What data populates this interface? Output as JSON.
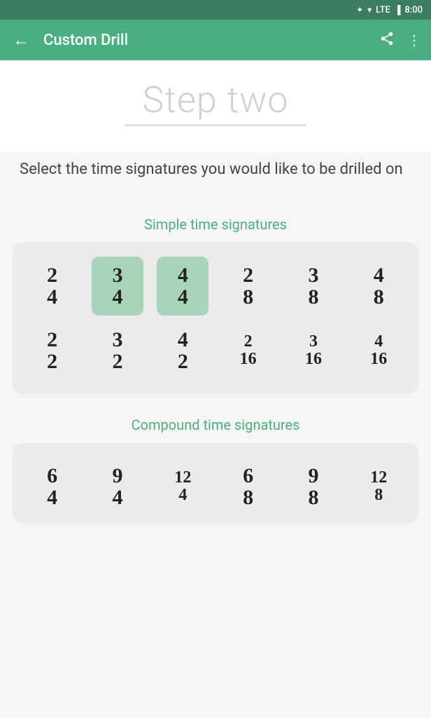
{
  "statusBar": {
    "time": "8:00",
    "bluetooth": "⚡",
    "wifi": "▲",
    "lte": "LTE",
    "battery": "▐"
  },
  "toolbar": {
    "back_icon": "←",
    "title": "Custom Drill",
    "share_icon": "⎋",
    "more_icon": "⋮"
  },
  "stepHeading": "Step two",
  "stepDescription": "Select the time signatures you would like to be drilled on",
  "simpleLabel": "Simple time signatures",
  "compoundLabel": "Compound time signatures",
  "simpleRow1": [
    {
      "top": "2",
      "bottom": "4",
      "selected": false
    },
    {
      "top": "3",
      "bottom": "4",
      "selected": true
    },
    {
      "top": "4",
      "bottom": "4",
      "selected": true
    },
    {
      "top": "2",
      "bottom": "8",
      "selected": false
    },
    {
      "top": "3",
      "bottom": "8",
      "selected": false
    },
    {
      "top": "4",
      "bottom": "8",
      "selected": false
    }
  ],
  "simpleRow2": [
    {
      "top": "2",
      "bottom": "2",
      "selected": false
    },
    {
      "top": "3",
      "bottom": "2",
      "selected": false
    },
    {
      "top": "4",
      "bottom": "2",
      "selected": false
    },
    {
      "top": "2",
      "bottom": "16",
      "selected": false,
      "small": true
    },
    {
      "top": "3",
      "bottom": "16",
      "selected": false,
      "small": true
    },
    {
      "top": "4",
      "bottom": "16",
      "selected": false,
      "small": true
    }
  ],
  "compoundRow1": [
    {
      "top": "6",
      "bottom": "4",
      "selected": false
    },
    {
      "top": "9",
      "bottom": "4",
      "selected": false
    },
    {
      "top": "12",
      "bottom": "4",
      "selected": false,
      "small": true
    },
    {
      "top": "6",
      "bottom": "8",
      "selected": false
    },
    {
      "top": "9",
      "bottom": "8",
      "selected": false
    },
    {
      "top": "12",
      "bottom": "8",
      "selected": false,
      "small": true
    }
  ]
}
